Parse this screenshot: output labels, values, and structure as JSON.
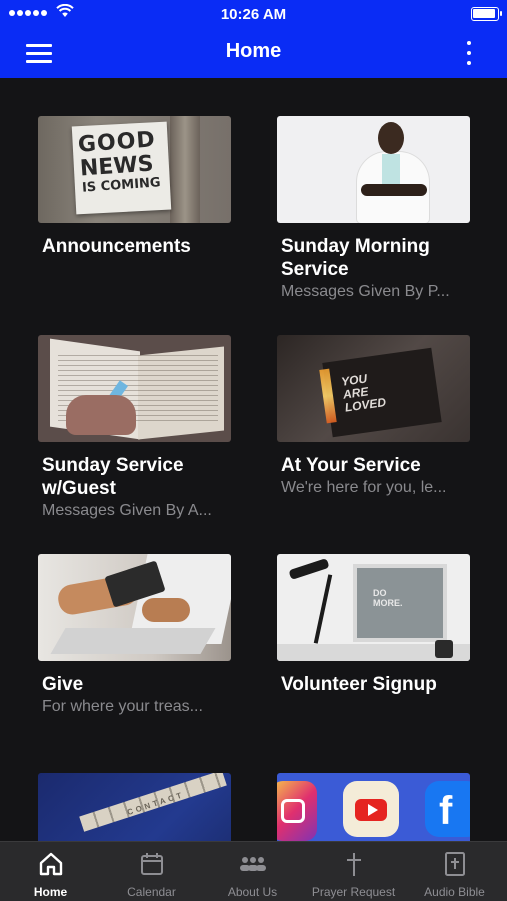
{
  "status_bar": {
    "time": "10:26 AM",
    "signal_bars": 5,
    "battery_level": 0.9
  },
  "nav": {
    "title": "Home",
    "menu_icon": "hamburger-menu-icon",
    "more_icon": "vertical-ellipsis-icon",
    "accent": "#0a2cf5"
  },
  "cards": [
    {
      "title": "Announcements",
      "subtitle": ""
    },
    {
      "title": "Sunday Morning Service",
      "subtitle": "Messages Given By P..."
    },
    {
      "title": "Sunday Service w/Guest",
      "subtitle": "Messages Given By A..."
    },
    {
      "title": "At Your Service",
      "subtitle": "We're here for you, le..."
    },
    {
      "title": "Give",
      "subtitle": "For where your treas..."
    },
    {
      "title": "Volunteer Signup",
      "subtitle": ""
    },
    {
      "title": "",
      "subtitle": ""
    },
    {
      "title": "",
      "subtitle": ""
    }
  ],
  "thumbnails": {
    "news": {
      "line1": "GOOD",
      "line2": "NEWS",
      "line3": "IS COMING"
    },
    "loved": {
      "text": "YOU ARE LOVED"
    },
    "desk": {
      "text": "DO MORE."
    },
    "contact": {
      "text": "CONTACT"
    },
    "facebook": {
      "letter": "f"
    }
  },
  "tabs": [
    {
      "label": "Home",
      "icon": "home-icon",
      "active": true
    },
    {
      "label": "Calendar",
      "icon": "calendar-icon",
      "active": false
    },
    {
      "label": "About Us",
      "icon": "people-group-icon",
      "active": false
    },
    {
      "label": "Prayer Request",
      "icon": "cross-icon",
      "active": false
    },
    {
      "label": "Audio Bible",
      "icon": "bible-icon",
      "active": false
    }
  ]
}
